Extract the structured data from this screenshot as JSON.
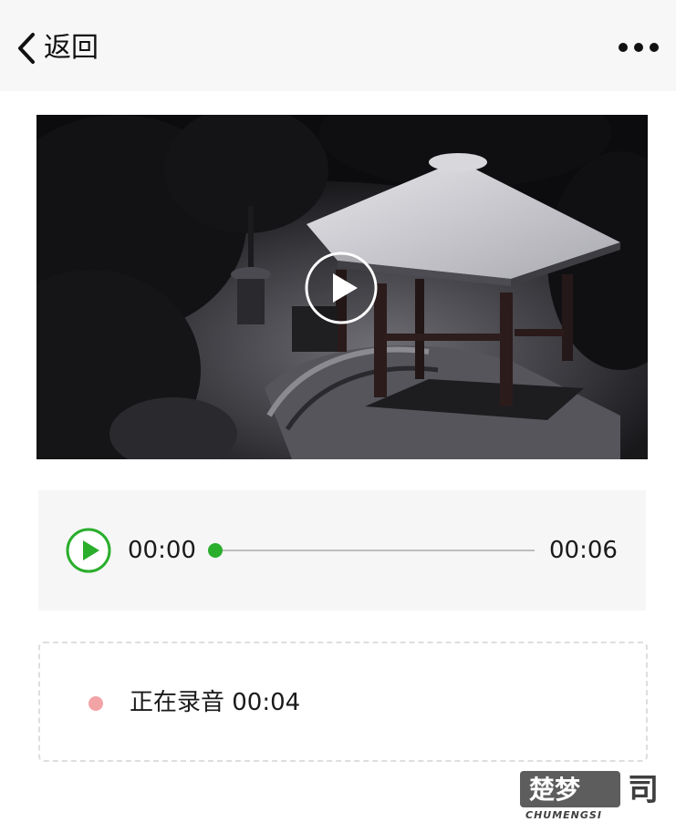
{
  "nav": {
    "back_label": "返回",
    "back_icon": "chevron-left-icon",
    "more_icon": "more-horizontal-icon"
  },
  "video": {
    "play_icon": "play-circle-icon"
  },
  "audio": {
    "play_icon": "play-icon",
    "current_time": "00:00",
    "total_time": "00:06",
    "progress": 0,
    "accent_color": "#2aae2c"
  },
  "recording": {
    "text": "正在录音 00:04",
    "indicator_color": "#f2a3a6"
  }
}
